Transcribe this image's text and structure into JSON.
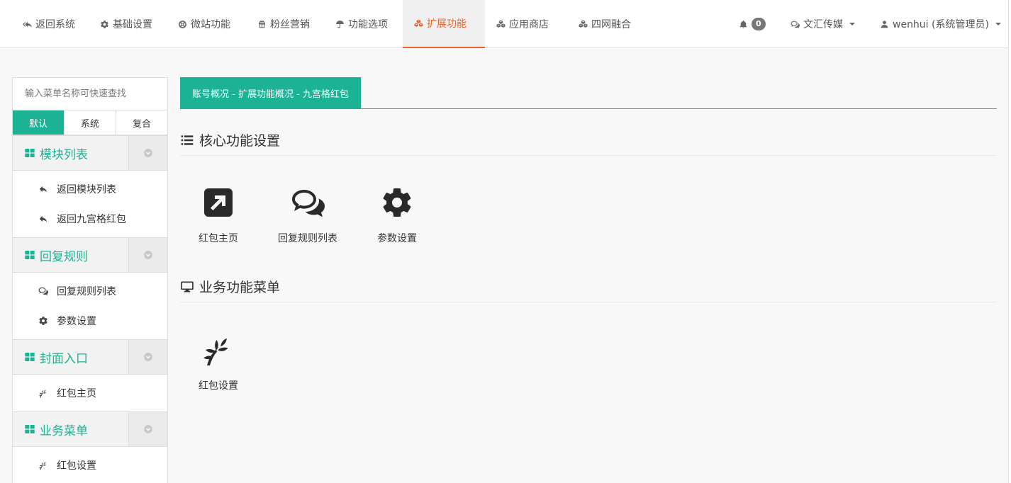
{
  "topnav": {
    "items": [
      {
        "label": "返回系统",
        "icon": "reply-all-icon"
      },
      {
        "label": "基础设置",
        "icon": "gear-icon"
      },
      {
        "label": "微站功能",
        "icon": "life-ring-icon"
      },
      {
        "label": "粉丝营销",
        "icon": "gift-icon"
      },
      {
        "label": "功能选项",
        "icon": "umbrella-icon"
      },
      {
        "label": "扩展功能",
        "icon": "cubes-icon",
        "active": true
      },
      {
        "label": "应用商店",
        "icon": "cubes-icon"
      },
      {
        "label": "四网融合",
        "icon": "cubes-icon"
      }
    ],
    "notifications_count": "0",
    "account_label": "文汇传媒",
    "user_label": "wenhui (系统管理员)",
    "accent_color": "#f0622b"
  },
  "sidebar": {
    "search_placeholder": "输入菜单名称可快速查找",
    "tabs": [
      "默认",
      "系统",
      "复合"
    ],
    "groups": [
      {
        "title": "模块列表",
        "items": [
          {
            "label": "返回模块列表",
            "icon": "reply-icon"
          },
          {
            "label": "返回九宫格红包",
            "icon": "reply-icon"
          }
        ]
      },
      {
        "title": "回复规则",
        "items": [
          {
            "label": "回复规则列表",
            "icon": "comments-icon"
          },
          {
            "label": "参数设置",
            "icon": "gear-icon"
          }
        ]
      },
      {
        "title": "封面入口",
        "items": [
          {
            "label": "红包主页",
            "icon": "leaf-icon"
          }
        ]
      },
      {
        "title": "业务菜单",
        "items": [
          {
            "label": "红包设置",
            "icon": "leaf-icon"
          }
        ]
      }
    ],
    "accent_color": "#1bb394"
  },
  "main": {
    "breadcrumb": "账号概况 - 扩展功能概况 - 九宫格红包",
    "sections": [
      {
        "title": "核心功能设置",
        "icon": "list-icon",
        "tiles": [
          {
            "label": "红包主页",
            "icon": "external-link-square-icon"
          },
          {
            "label": "回复规则列表",
            "icon": "comments-icon"
          },
          {
            "label": "参数设置",
            "icon": "gear-icon"
          }
        ]
      },
      {
        "title": "业务功能菜单",
        "icon": "desktop-icon",
        "tiles": [
          {
            "label": "红包设置",
            "icon": "leaf-icon"
          }
        ]
      }
    ]
  }
}
